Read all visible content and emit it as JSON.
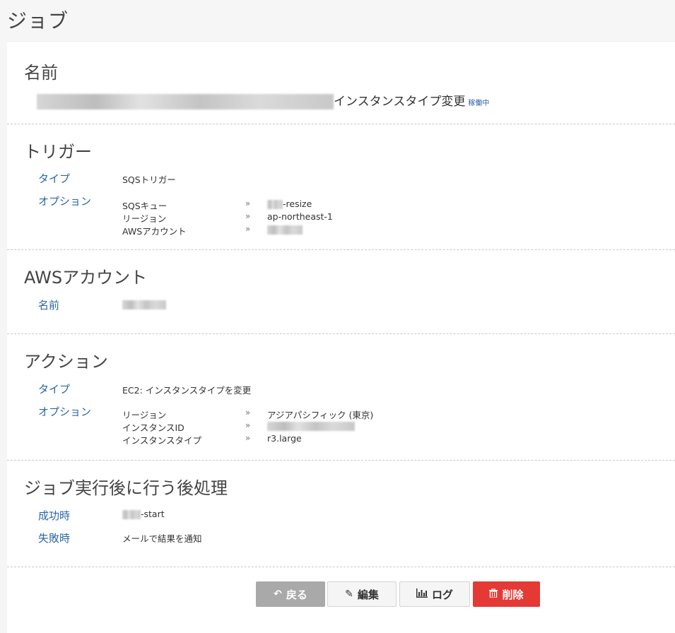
{
  "page": {
    "title": "ジョブ"
  },
  "name_section": {
    "heading": "名前",
    "job_name_suffix": "インスタンスタイプ変更",
    "status": "稼働中"
  },
  "trigger": {
    "heading": "トリガー",
    "type_label": "タイプ",
    "type_value": "SQSトリガー",
    "options_label": "オプション",
    "options": [
      {
        "key": "SQSキュー",
        "value": "-resize"
      },
      {
        "key": "リージョン",
        "value": "ap-northeast-1"
      },
      {
        "key": "AWSアカウント",
        "value": ""
      }
    ]
  },
  "aws_account": {
    "heading": "AWSアカウント",
    "name_label": "名前"
  },
  "action": {
    "heading": "アクション",
    "type_label": "タイプ",
    "type_value": "EC2: インスタンスタイプを変更",
    "options_label": "オプション",
    "options": [
      {
        "key": "リージョン",
        "value": "アジアパシフィック (東京)"
      },
      {
        "key": "インスタンスID",
        "value": ""
      },
      {
        "key": "インスタンスタイプ",
        "value": "r3.large"
      }
    ]
  },
  "post_process": {
    "heading": "ジョブ実行後に行う後処理",
    "success_label": "成功時",
    "success_value": "-start",
    "failure_label": "失敗時",
    "failure_value": "メールで結果を通知"
  },
  "buttons": {
    "back": "戻る",
    "edit": "編集",
    "log": "ログ",
    "delete": "削除"
  },
  "option_arrow": "»"
}
